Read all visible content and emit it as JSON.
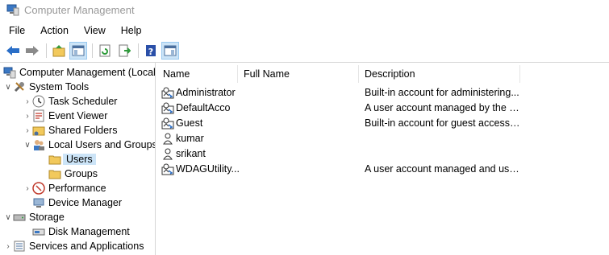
{
  "window": {
    "title": "Computer Management"
  },
  "menu": [
    "File",
    "Action",
    "View",
    "Help"
  ],
  "toolbar": {
    "buttons": [
      "back-icon",
      "forward-icon",
      "up-folder-icon",
      "show-hide-tree-icon",
      "refresh-icon",
      "export-list-icon",
      "help-icon",
      "show-hide-action-pane-icon"
    ]
  },
  "tree": {
    "root": "Computer Management (Local",
    "system_tools": "System Tools",
    "task_scheduler": "Task Scheduler",
    "event_viewer": "Event Viewer",
    "shared_folders": "Shared Folders",
    "local_users_groups": "Local Users and Groups",
    "users": "Users",
    "groups": "Groups",
    "performance": "Performance",
    "device_manager": "Device Manager",
    "storage": "Storage",
    "disk_management": "Disk Management",
    "services_apps": "Services and Applications"
  },
  "list": {
    "columns": [
      "Name",
      "Full Name",
      "Description"
    ],
    "rows": [
      {
        "name": "Administrator",
        "full_name": "",
        "description": "Built-in account for administering..."
      },
      {
        "name": "DefaultAcco",
        "full_name": "",
        "description": "A user account managed by the s..."
      },
      {
        "name": "Guest",
        "full_name": "",
        "description": "Built-in account for guest access t..."
      },
      {
        "name": "kumar",
        "full_name": "",
        "description": ""
      },
      {
        "name": "srikant",
        "full_name": "",
        "description": ""
      },
      {
        "name": "WDAGUtility...",
        "full_name": "",
        "description": "A user account managed and use..."
      }
    ]
  },
  "colors": {
    "selection": "#cce4f7",
    "folder": "#f2c95c",
    "accent": "#2a6ec7"
  }
}
